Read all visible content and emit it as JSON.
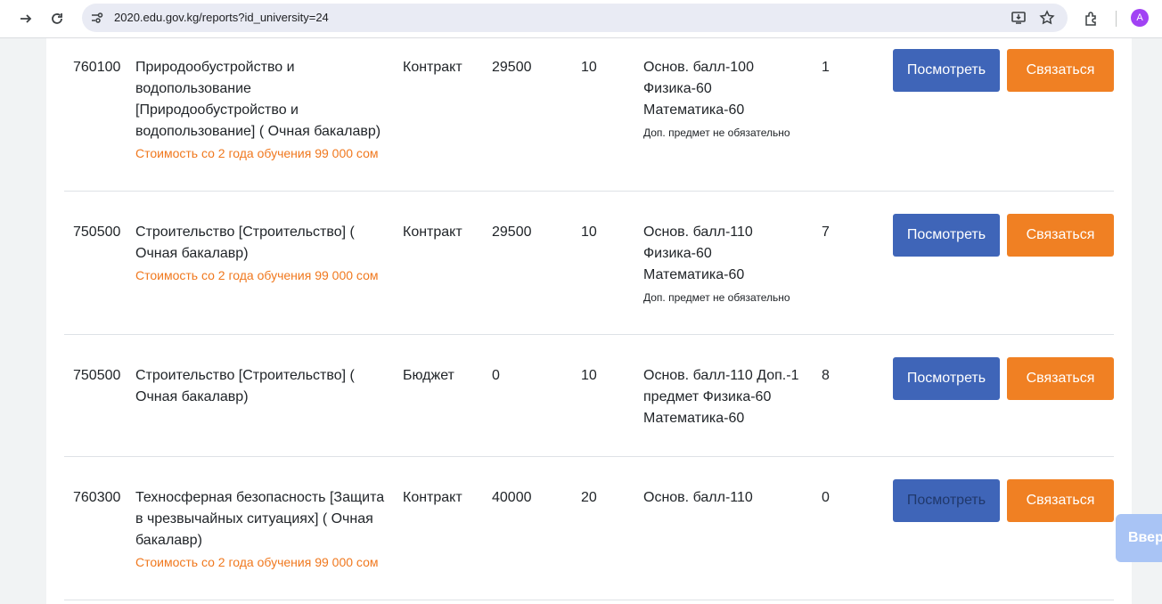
{
  "browser": {
    "url": "2020.edu.gov.kg/reports?id_university=24",
    "avatar_letter": "A"
  },
  "buttons": {
    "view": "Посмотреть",
    "contact": "Связаться",
    "to_top": "Ввер"
  },
  "rows": [
    {
      "code": "760100",
      "name": "Природообустройство и водопользование [Природообустройство и водопользование] ( Очная бакалавр)",
      "price_note": "Стоимость со 2 года обучения 99 000 сом",
      "type": "Контракт",
      "cost": "29500",
      "places": "10",
      "requirements": "Основ. балл-100 Физика-60 Математика-60",
      "extra": "Доп. предмет не обязательно",
      "count": "1"
    },
    {
      "code": "750500",
      "name": "Строительство [Строительство] ( Очная бакалавр)",
      "price_note": "Стоимость со 2 года обучения 99 000 сом",
      "type": "Контракт",
      "cost": "29500",
      "places": "10",
      "requirements": "Основ. балл-110 Физика-60 Математика-60",
      "extra": "Доп. предмет не обязательно",
      "count": "7"
    },
    {
      "code": "750500",
      "name": "Строительство [Строительство] ( Очная бакалавр)",
      "price_note": "",
      "type": "Бюджет",
      "cost": "0",
      "places": "10",
      "requirements": "Основ. балл-110 Доп.-1 предмет Физика-60 Математика-60",
      "extra": "",
      "count": "8"
    },
    {
      "code": "760300",
      "name": "Техносферная безопасность [Защита в чрезвычайных ситуациях] ( Очная бакалавр)",
      "price_note": "Стоимость со 2 года обучения 99 000 сом",
      "type": "Контракт",
      "cost": "40000",
      "places": "20",
      "requirements": "Основ. балл-110",
      "extra": "",
      "count": "0"
    }
  ]
}
